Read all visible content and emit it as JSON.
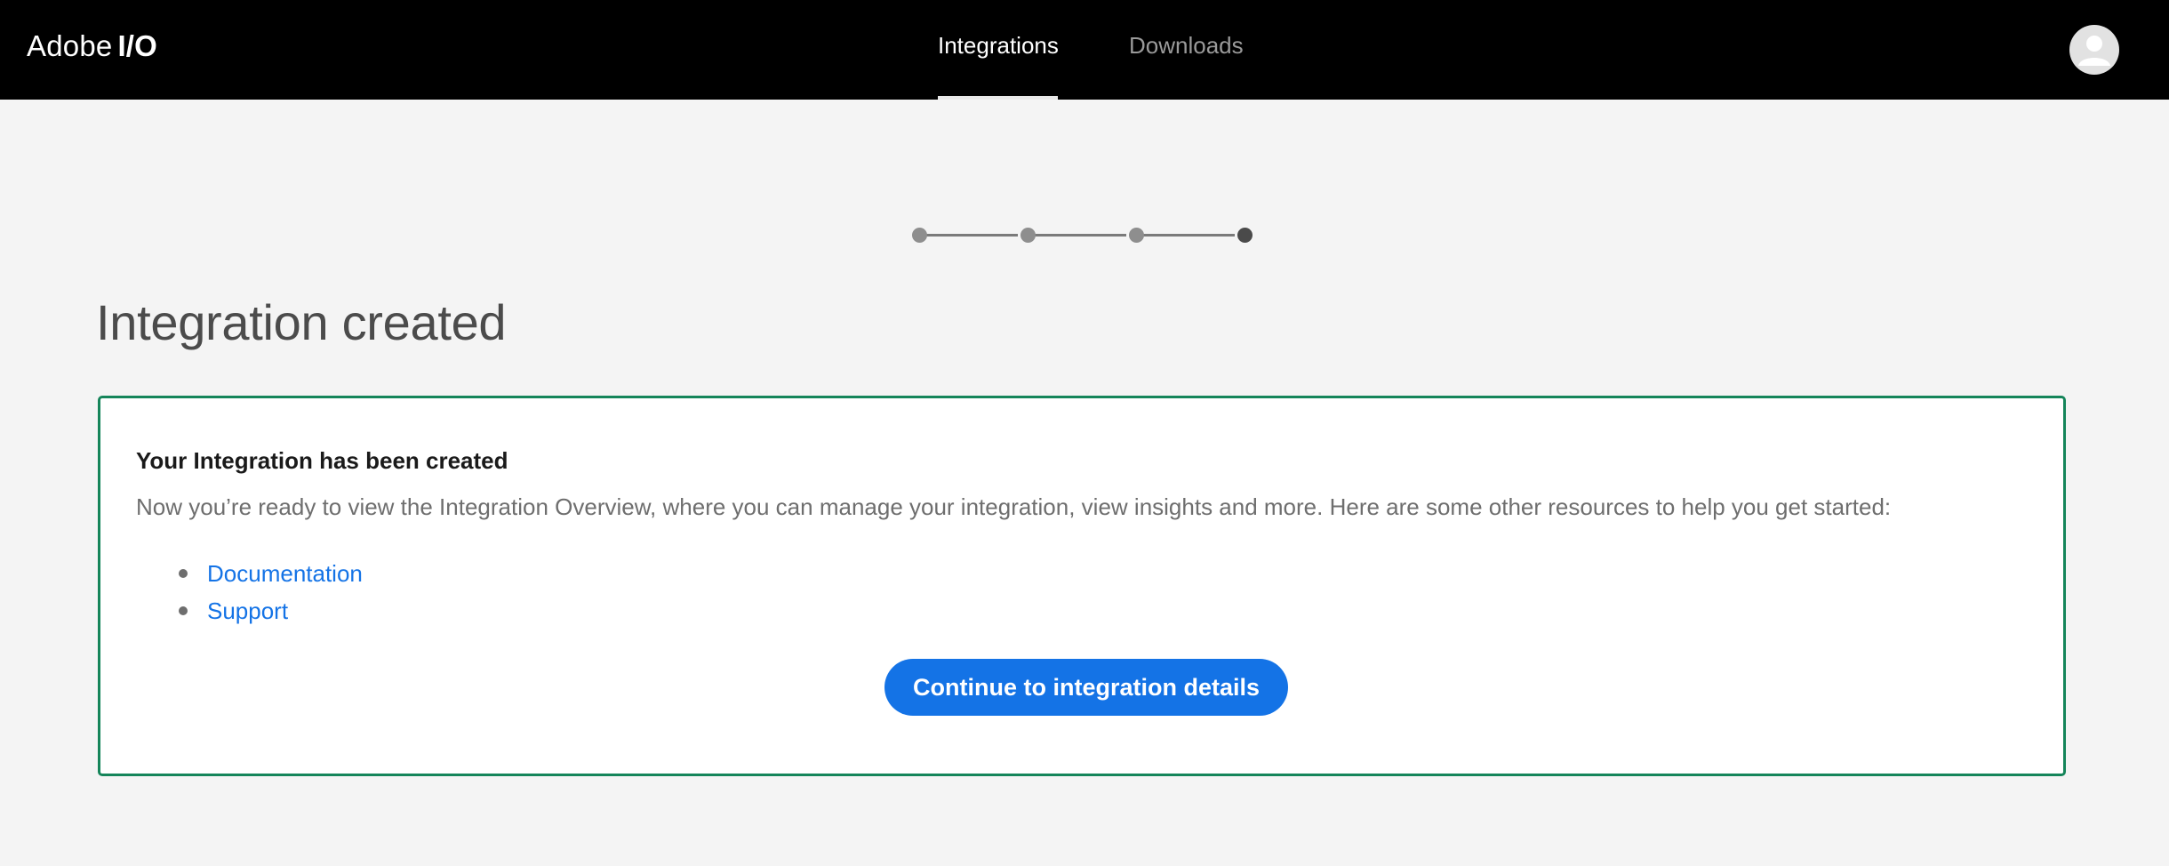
{
  "header": {
    "brand_prefix": "Adobe",
    "brand_suffix": "I/O",
    "tabs": [
      {
        "label": "Integrations",
        "active": true
      },
      {
        "label": "Downloads",
        "active": false
      }
    ],
    "avatar_icon": "user-avatar-icon"
  },
  "stepper": {
    "total_steps": 4,
    "current_step": 4
  },
  "page": {
    "title": "Integration created"
  },
  "card": {
    "heading": "Your Integration has been created",
    "text": "Now you’re ready to view the Integration Overview, where you can manage your integration, view insights and more. Here are some other resources to help you get started:",
    "links": [
      {
        "label": "Documentation"
      },
      {
        "label": "Support"
      }
    ],
    "button_label": "Continue to integration details"
  },
  "colors": {
    "header_bg": "#000000",
    "page_bg": "#f4f4f4",
    "card_border": "#15855a",
    "link": "#1473e6",
    "button_bg": "#1473e6"
  }
}
